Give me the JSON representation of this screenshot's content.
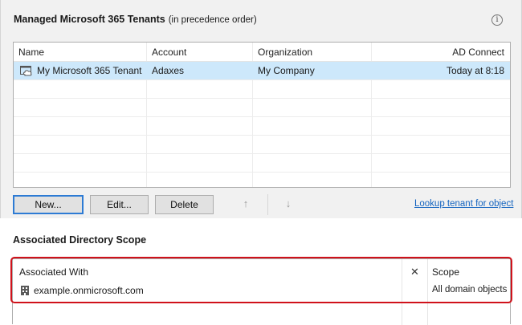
{
  "tenants_section": {
    "title": "Managed Microsoft 365 Tenants",
    "subtitle": "(in precedence order)",
    "info_icon": "info-icon",
    "columns": [
      "Name",
      "Account",
      "Organization",
      "AD Connect"
    ],
    "rows": [
      {
        "name": "My Microsoft 365 Tenant",
        "account": "Adaxes",
        "organization": "My Company",
        "ad_connect": "Today at 8:18",
        "selected": true
      }
    ],
    "buttons": {
      "new": "New...",
      "edit": "Edit...",
      "delete": "Delete"
    },
    "arrows": {
      "up": "↑",
      "down": "↓"
    },
    "lookup_link": "Lookup tenant for object"
  },
  "scope_section": {
    "title": "Associated Directory Scope",
    "columns": {
      "associated_with": "Associated With",
      "remove": "✕",
      "scope": "Scope"
    },
    "rows": [
      {
        "associated_with": "example.onmicrosoft.com",
        "scope": "All domain objects"
      }
    ]
  },
  "colors": {
    "selection": "#cde8fb",
    "highlight": "#d0121b",
    "link": "#1565c0",
    "primary_border": "#2d7bd4"
  }
}
